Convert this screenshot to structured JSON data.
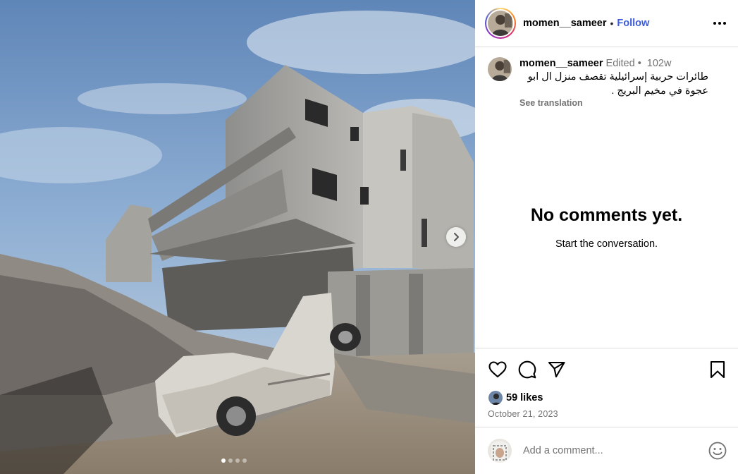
{
  "post": {
    "username": "momen__sameer",
    "follow_label": "Follow",
    "separator": "•",
    "more_icon": "more-horizontal-icon"
  },
  "caption": {
    "username": "momen__sameer",
    "edited_label": "Edited",
    "dot": "•",
    "age": "102w",
    "text": "طائرات حربية إسرائيلية تقصف منزل ال ابو عجوة في مخيم البريج .",
    "see_translation": "See translation"
  },
  "comments": {
    "empty_title": "No comments yet.",
    "empty_subtitle": "Start the conversation."
  },
  "actions": {
    "icons": [
      "heart-icon",
      "comment-icon",
      "share-icon",
      "bookmark-icon"
    ]
  },
  "likes": {
    "label": "59 likes"
  },
  "date": "October 21, 2023",
  "add_comment": {
    "placeholder": "Add a comment...",
    "emoji_icon": "emoji-icon"
  },
  "carousel": {
    "slide_count": 4,
    "active_index": 0
  },
  "colors": {
    "follow": "#3b5bdb",
    "border": "#dbdbdb",
    "muted": "#737373"
  }
}
